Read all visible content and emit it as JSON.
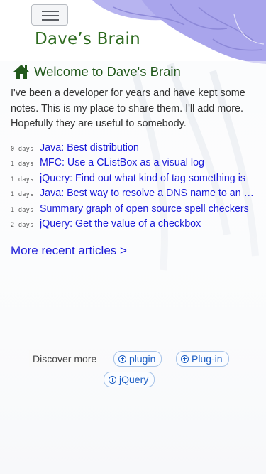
{
  "header": {
    "site_title": "Dave’s Brain",
    "menu_icon": "hamburger-icon"
  },
  "main": {
    "welcome": {
      "icon": "home-icon",
      "heading": "Welcome to Dave's Brain"
    },
    "intro": "I've been a developer for years and have kept some notes. This is my place to share them. I'll add more. Hopefully they are useful to somebody.",
    "articles": [
      {
        "age": "0 days",
        "title": "Java: Best distribution"
      },
      {
        "age": "1 days",
        "title": "MFC: Use a CListBox as a visual log"
      },
      {
        "age": "1 days",
        "title": "jQuery: Find out what kind of tag something is"
      },
      {
        "age": "1 days",
        "title": "Java: Best way to resolve a DNS name to an IP address"
      },
      {
        "age": "1 days",
        "title": "Summary graph of open source spell checkers"
      },
      {
        "age": "2 days",
        "title": "jQuery: Get the value of a checkbox"
      }
    ],
    "more_link": "More recent articles >"
  },
  "discover": {
    "label": "Discover more",
    "tags": [
      {
        "label": "plugin",
        "icon": "plus-circle-icon"
      },
      {
        "label": "Plug-in",
        "icon": "plus-circle-icon"
      },
      {
        "label": "jQuery",
        "icon": "plus-circle-icon"
      }
    ]
  },
  "colors": {
    "title_green": "#2e6b1f",
    "link_blue": "#1a1ad8",
    "tag_blue": "#1e5fc4",
    "brain_purple": "#b7b4f0"
  }
}
